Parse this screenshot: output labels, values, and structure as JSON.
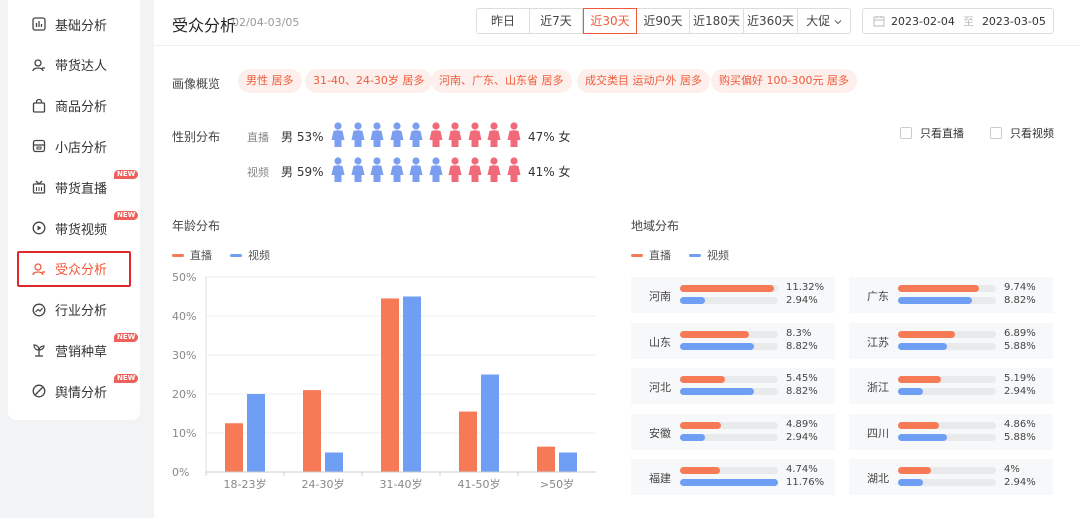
{
  "sidebar": {
    "items": [
      {
        "label": "基础分析",
        "icon": "bar-chart-icon",
        "new": false,
        "active": false
      },
      {
        "label": "带货达人",
        "icon": "user-icon",
        "new": false,
        "active": false
      },
      {
        "label": "商品分析",
        "icon": "shopping-bag-icon",
        "new": false,
        "active": false
      },
      {
        "label": "小店分析",
        "icon": "store-icon",
        "new": false,
        "active": false
      },
      {
        "label": "带货直播",
        "icon": "tv-icon",
        "new": true,
        "active": false
      },
      {
        "label": "带货视频",
        "icon": "play-icon",
        "new": true,
        "active": false
      },
      {
        "label": "受众分析",
        "icon": "user-icon",
        "new": false,
        "active": true
      },
      {
        "label": "行业分析",
        "icon": "trend-icon",
        "new": false,
        "active": false
      },
      {
        "label": "营销种草",
        "icon": "sprout-icon",
        "new": true,
        "active": false
      },
      {
        "label": "舆情分析",
        "icon": "opinion-icon",
        "new": true,
        "active": false
      }
    ],
    "new_badge": "NEW"
  },
  "header": {
    "title": "受众分析",
    "subtitle": "02/04-03/05",
    "ranges": [
      "昨日",
      "近7天",
      "近30天",
      "近90天",
      "近180天",
      "近360天",
      "大促"
    ],
    "active_range": "近30天",
    "date_start": "2023-02-04",
    "date_sep": "至",
    "date_end": "2023-03-05"
  },
  "portrait": {
    "label": "画像概览",
    "tags": [
      "男性 居多",
      "31-40、24-30岁 居多",
      "河南、广东、山东省 居多",
      "成交类目 运动户外 居多",
      "购买偏好 100-300元 居多"
    ]
  },
  "gender": {
    "label": "性别分布",
    "rows": [
      {
        "name": "直播",
        "male": "男 53%",
        "female": "47% 女",
        "male_count": 5
      },
      {
        "name": "视频",
        "male": "男 59%",
        "female": "41% 女",
        "male_count": 6
      }
    ],
    "only_live": "只看直播",
    "only_video": "只看视频",
    "colors": {
      "male": "#7b9ef0",
      "female": "#f06a7a"
    }
  },
  "age": {
    "title": "年龄分布",
    "legend": [
      "直播",
      "视频"
    ],
    "colors": {
      "live": "#f57a55",
      "video": "#6f9ef5"
    }
  },
  "region": {
    "title": "地域分布",
    "legend": [
      "直播",
      "视频"
    ],
    "left": [
      {
        "name": "河南",
        "live": "11.32%",
        "video": "2.94%",
        "lv": 11.32,
        "vv": 2.94
      },
      {
        "name": "山东",
        "live": "8.3%",
        "video": "8.82%",
        "lv": 8.3,
        "vv": 8.82
      },
      {
        "name": "河北",
        "live": "5.45%",
        "video": "8.82%",
        "lv": 5.45,
        "vv": 8.82
      },
      {
        "name": "安徽",
        "live": "4.89%",
        "video": "2.94%",
        "lv": 4.89,
        "vv": 2.94
      },
      {
        "name": "福建",
        "live": "4.74%",
        "video": "11.76%",
        "lv": 4.74,
        "vv": 11.76
      }
    ],
    "right": [
      {
        "name": "广东",
        "live": "9.74%",
        "video": "8.82%",
        "lv": 9.74,
        "vv": 8.82
      },
      {
        "name": "江苏",
        "live": "6.89%",
        "video": "5.88%",
        "lv": 6.89,
        "vv": 5.88
      },
      {
        "name": "浙江",
        "live": "5.19%",
        "video": "2.94%",
        "lv": 5.19,
        "vv": 2.94
      },
      {
        "name": "四川",
        "live": "4.86%",
        "video": "5.88%",
        "lv": 4.86,
        "vv": 5.88
      },
      {
        "name": "湖北",
        "live": "4%",
        "video": "2.94%",
        "lv": 4,
        "vv": 2.94
      }
    ]
  },
  "chart_data": {
    "type": "bar",
    "categories": [
      "18-23岁",
      "24-30岁",
      "31-40岁",
      "41-50岁",
      ">50岁"
    ],
    "series": [
      {
        "name": "直播",
        "values": [
          12.5,
          21,
          44.5,
          15.5,
          6.5
        ]
      },
      {
        "name": "视频",
        "values": [
          20,
          5,
          45,
          25,
          5
        ]
      }
    ],
    "yticks": [
      "0%",
      "10%",
      "20%",
      "30%",
      "40%",
      "50%"
    ],
    "ylim": [
      0,
      50
    ],
    "grid": true,
    "legend": "top-left"
  }
}
